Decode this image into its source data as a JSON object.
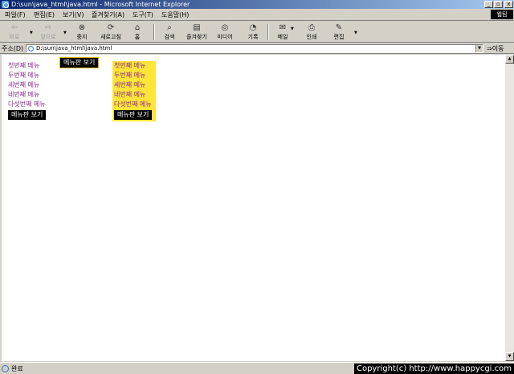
{
  "window": {
    "title": "D:\\sun\\java_html\\java.html - Microsoft Internet Explorer",
    "buttons": [
      "_",
      "▫",
      "x"
    ]
  },
  "menubar": {
    "items": [
      "파일(F)",
      "편집(E)",
      "보기(V)",
      "즐겨찾기(A)",
      "도구(T)",
      "도움말(H)"
    ],
    "brand": "웹팀"
  },
  "toolbar": {
    "back": "뒤로",
    "forward": "앞으로",
    "stop": "중지",
    "refresh": "새로고침",
    "home": "홈",
    "search": "검색",
    "favorites": "즐겨찾기",
    "media": "미디어",
    "history": "기록",
    "mail": "메일",
    "print": "인쇄",
    "edit": "편집"
  },
  "address": {
    "label": "주소(D)",
    "value": "D:\\sun\\java_html\\java.html",
    "go": "이동"
  },
  "page": {
    "left_menu": {
      "items": [
        "첫번째 메뉴",
        "두번째 메뉴",
        "세번째 메뉴",
        "네번째 메뉴",
        "다섯번째 메뉴"
      ],
      "button": "메뉴판 보기"
    },
    "popup_button": "메뉴판 보기",
    "right_menu": {
      "items": [
        "첫번째 메뉴",
        "두번째 메뉴",
        "세번째 메뉴",
        "네번째 메뉴",
        "다섯번째 메뉴"
      ],
      "button": "메뉴판 보기"
    }
  },
  "status": {
    "text": "완료",
    "copyright": "Copyright(c) http://www.happycgi.com"
  },
  "colors": {
    "menu_text": "#8b2a8b",
    "right_menu_bg": "#ffe43a",
    "button_bg": "#000000"
  }
}
